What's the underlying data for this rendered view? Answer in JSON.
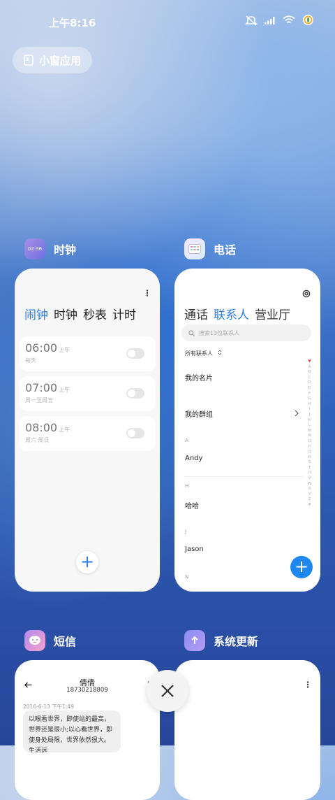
{
  "status_bar": {
    "time": "上午8:16"
  },
  "small_window_button": {
    "label": "小窗应用"
  },
  "apps": {
    "clock": {
      "title": "时钟",
      "icon_text": "02:36",
      "tabs": [
        "闹钟",
        "时钟",
        "秒表",
        "计时"
      ],
      "alarms": [
        {
          "time": "06:00",
          "ampm": "上午",
          "repeat": "每天"
        },
        {
          "time": "07:00",
          "ampm": "上午",
          "repeat": "周一至周五"
        },
        {
          "time": "08:00",
          "ampm": "上午",
          "repeat": "周六 周日"
        }
      ],
      "add_symbol": "+"
    },
    "phone": {
      "title": "电话",
      "tabs": [
        "通话",
        "联系人",
        "营业厅"
      ],
      "search_placeholder": "搜索13位联系人",
      "filter_label": "所有联系人",
      "my_card": "我的名片",
      "my_groups": "我的群组",
      "sections": [
        {
          "letter": "A",
          "name": "Andy"
        },
        {
          "letter": "H",
          "name": "哈哈"
        },
        {
          "letter": "J",
          "name": "Jason"
        },
        {
          "letter": "N",
          "name": ""
        }
      ],
      "alphabet": [
        "♥",
        "A",
        "B",
        "C",
        "D",
        "E",
        "F",
        "G",
        "H",
        "I",
        "J",
        "K",
        "L",
        "M",
        "N",
        "O",
        "P",
        "Q",
        "R",
        "S",
        "T",
        "U",
        "V",
        "W",
        "X",
        "Y",
        "Z",
        "#"
      ],
      "add_symbol": "+"
    },
    "sms": {
      "title": "短信",
      "contact_name": "倩倩",
      "contact_number": "18730218809",
      "message_date": "2016-6-13 下午1:49",
      "message_text": "以眼看世界，即使站的最高，世界还是很小;以心看世界，即使身处局限，世界依然很大。生活远"
    },
    "update": {
      "title": "系统更新"
    }
  }
}
